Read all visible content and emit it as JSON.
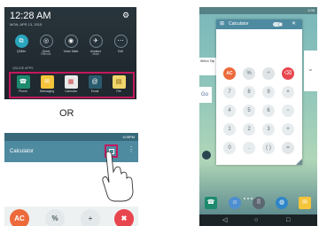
{
  "shade": {
    "time": "12:28 AM",
    "date": "MON, APR 13, 2015",
    "gear_icon": "gear-icon",
    "quick_settings": [
      {
        "label": "QSlide",
        "sub": "",
        "icon": "qslide-icon",
        "glyph": "⧉",
        "active": true
      },
      {
        "label": "Quick",
        "sub": "Remote",
        "icon": "remote-icon",
        "glyph": "◎",
        "active": false
      },
      {
        "label": "Voice Mate",
        "sub": "",
        "icon": "voice-icon",
        "glyph": "◉",
        "active": false
      },
      {
        "label": "Airplane",
        "sub": "mode",
        "icon": "airplane-icon",
        "glyph": "✈",
        "active": false
      },
      {
        "label": "Edit",
        "sub": "",
        "icon": "edit-icon",
        "glyph": "⋯",
        "active": false
      }
    ],
    "slide_label": "QSLIDE APPS",
    "apps": [
      {
        "label": "Phone",
        "icon": "phone-icon",
        "glyph": "☎",
        "color": "#1d8a6e"
      },
      {
        "label": "Messaging",
        "icon": "messaging-icon",
        "glyph": "✉",
        "color": "#f4c43a"
      },
      {
        "label": "Calendar",
        "icon": "calendar-icon",
        "glyph": "▦",
        "color": "#e9e9e9"
      },
      {
        "label": "Email",
        "icon": "email-icon",
        "glyph": "@",
        "color": "#2a5b6e"
      },
      {
        "label": "File",
        "icon": "file-manager-icon",
        "glyph": "▤",
        "color": "#efd56a"
      }
    ]
  },
  "or_text": "OR",
  "calculator": {
    "status_time": "3:09PM",
    "title": "Calculator",
    "mini_icon": "qslide-icon",
    "menu_icon": "overflow-menu-icon",
    "keys": [
      {
        "label": "AC",
        "bg": "#ed6a3a",
        "fg": "#ffffff"
      },
      {
        "label": "%",
        "bg": "#e3e8ea",
        "fg": "#4b5a60"
      },
      {
        "label": "÷",
        "bg": "#e3e8ea",
        "fg": "#4b5a60"
      },
      {
        "label": "✖",
        "bg": "#e8464f",
        "fg": "#ffffff"
      }
    ]
  },
  "phone": {
    "status_time": "1:09",
    "float_window": {
      "title": "Calculator",
      "close": "✕",
      "keys": [
        "AC",
        "%",
        "÷",
        "⌫",
        "7",
        "8",
        "9",
        "×",
        "4",
        "5",
        "6",
        "−",
        "1",
        "2",
        "3",
        "+",
        "0",
        ".",
        "( )",
        "="
      ]
    },
    "bg_left_text": "Welco Tap",
    "bg_left_g": "Go",
    "dock": [
      {
        "icon": "phone-icon",
        "glyph": "☎",
        "color": "#1d8a6e"
      },
      {
        "icon": "contacts-icon",
        "glyph": "☺",
        "color": "#4e8fd0"
      },
      {
        "icon": "apps-icon",
        "glyph": "⠿",
        "color": "#5b6670"
      },
      {
        "icon": "internet-icon",
        "glyph": "◍",
        "color": "#2f86c8"
      },
      {
        "icon": "messaging-icon",
        "glyph": "✉",
        "color": "#f4c43a"
      }
    ],
    "nav": [
      {
        "icon": "back-icon",
        "glyph": "◁"
      },
      {
        "icon": "home-icon",
        "glyph": "○"
      },
      {
        "icon": "recents-icon",
        "glyph": "□"
      }
    ]
  }
}
